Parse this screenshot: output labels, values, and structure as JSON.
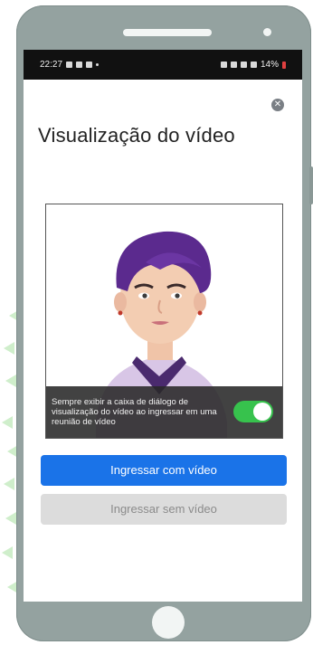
{
  "status_bar": {
    "time": "22:27",
    "battery": "14%"
  },
  "dialog": {
    "title": "Visualização do vídeo",
    "close_icon": "close-icon",
    "preview": {
      "avatar_icon": "person-avatar-illustration",
      "overlay_text": "Sempre exibir a caixa de diálogo de visualização do vídeo ao ingressar em uma reunião de vídeo",
      "toggle_on": true
    },
    "buttons": {
      "join_with_video": "Ingressar com vídeo",
      "join_without_video": "Ingressar sem vídeo"
    }
  },
  "colors": {
    "primary_button": "#1a73e8",
    "secondary_button": "#dcdcdc",
    "toggle_on": "#37c24d",
    "phone_frame": "#94a2a0"
  }
}
